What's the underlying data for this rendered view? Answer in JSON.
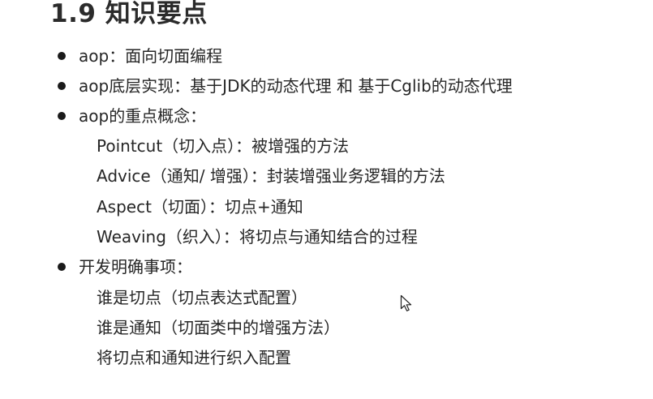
{
  "slide": {
    "title": "1.9 知识要点"
  },
  "bullets": [
    {
      "text": "aop：面向切面编程"
    },
    {
      "text": "aop底层实现：基于JDK的动态代理 和 基于Cglib的动态代理"
    },
    {
      "text": "aop的重点概念：",
      "subitems": [
        "Pointcut（切入点）：被增强的方法",
        "Advice（通知/ 增强）：封装增强业务逻辑的方法",
        "Aspect（切面）：切点+通知",
        "Weaving（织入）：将切点与通知结合的过程"
      ]
    },
    {
      "text": "开发明确事项：",
      "subitems": [
        "谁是切点（切点表达式配置）",
        "谁是通知（切面类中的增强方法）",
        "将切点和通知进行织入配置"
      ]
    }
  ],
  "icons": {
    "cursor": "mouse-pointer-icon"
  }
}
